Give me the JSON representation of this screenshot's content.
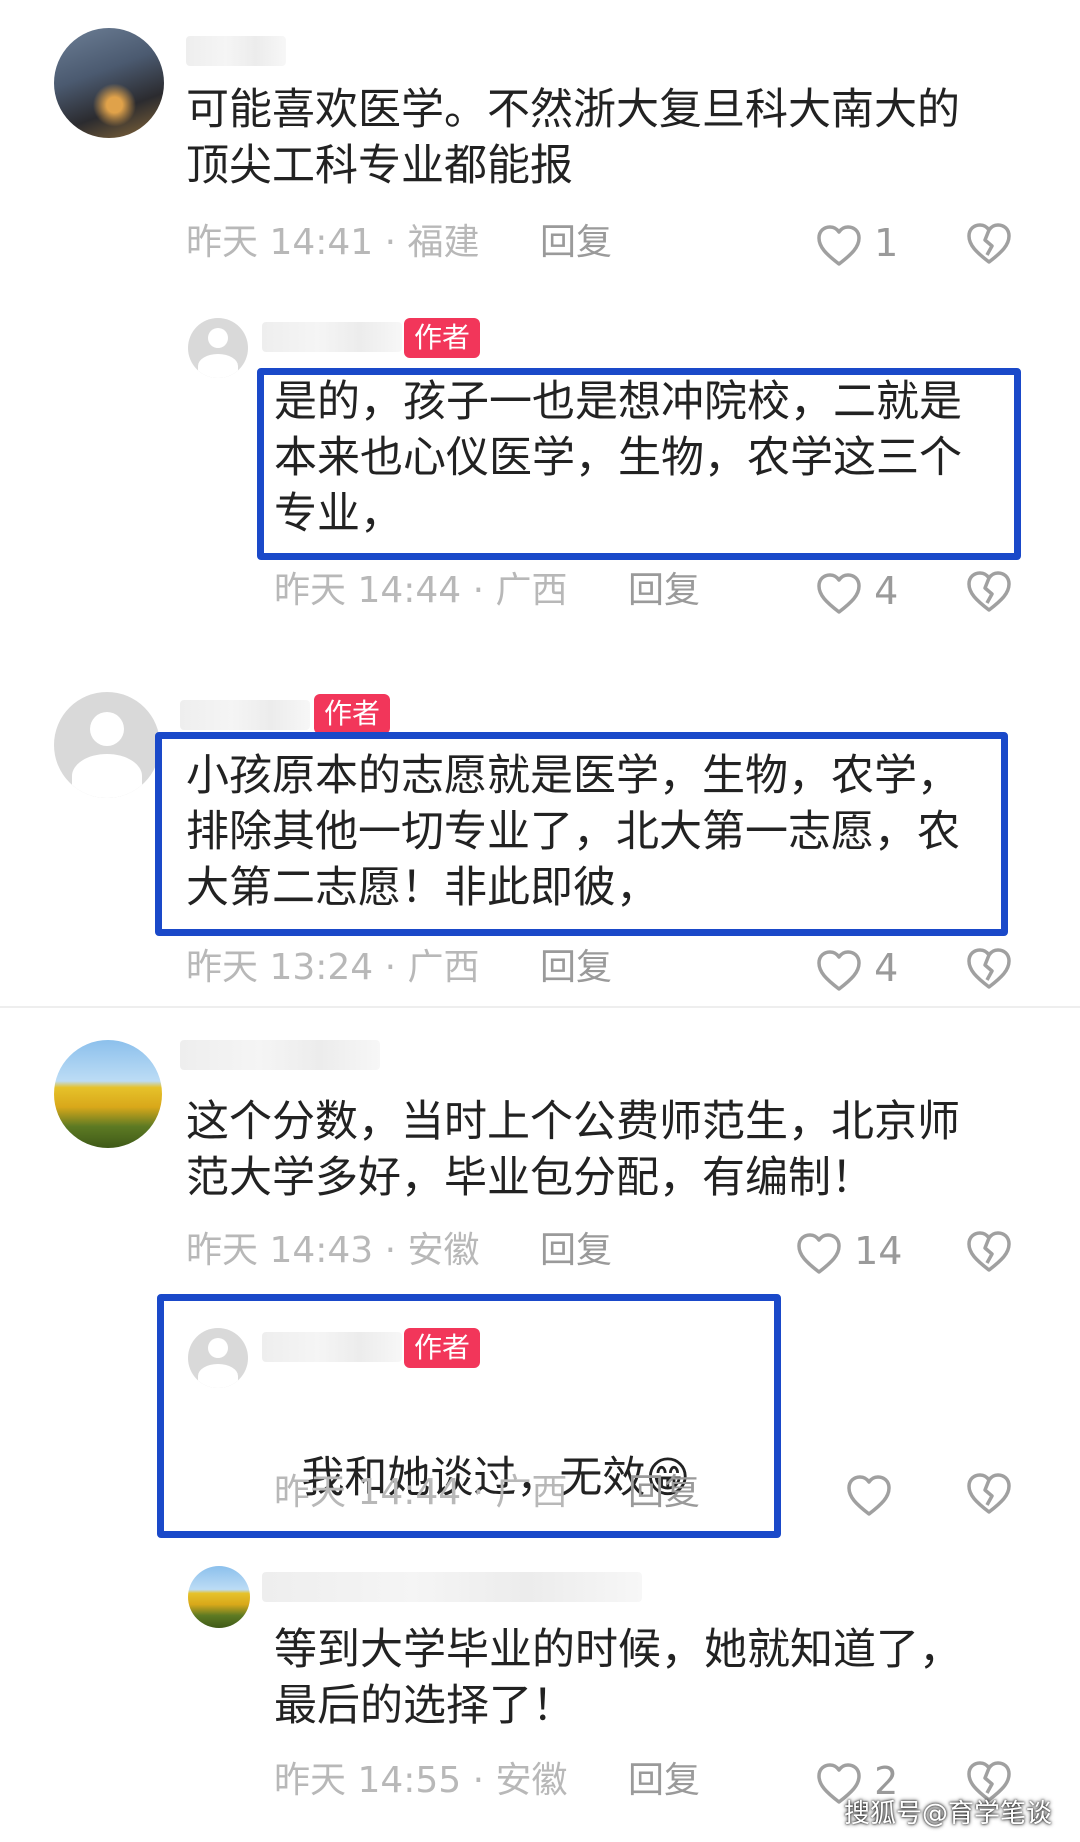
{
  "comments": [
    {
      "text": "可能喜欢医学。不然浙大复旦科大南大的\n顶尖工科专业都能报",
      "meta": "昨天 14:41 · 福建",
      "reply": "回复",
      "likes": "1"
    },
    {
      "badge": "作者",
      "text": "是的，孩子一也是想冲院校，二就是\n本来也心仪医学，生物，农学这三个\n专业，",
      "meta": "昨天 14:44 · 广西",
      "reply": "回复",
      "likes": "4"
    },
    {
      "badge": "作者",
      "text": "小孩原本的志愿就是医学，生物，农学，\n排除其他一切专业了，北大第一志愿，农\n大第二志愿！非此即彼，",
      "meta": "昨天 13:24 · 广西",
      "reply": "回复",
      "likes": "4"
    },
    {
      "text": "这个分数，当时上个公费师范生，北京师\n范大学多好，毕业包分配，有编制！",
      "meta": "昨天 14:43 · 安徽",
      "reply": "回复",
      "likes": "14"
    },
    {
      "badge": "作者",
      "text": "我和她谈过，无效",
      "emoji": "😁",
      "meta": "昨天 14:44 · 广西",
      "reply": "回复",
      "likes": ""
    },
    {
      "text": "等到大学毕业的时候，她就知道了，\n最后的选择了！",
      "meta": "昨天 14:55 · 安徽",
      "reply": "回复",
      "likes": "2"
    }
  ],
  "watermark": "搜狐号@育学笔谈",
  "colors": {
    "highlight_border": "#1a49c9",
    "badge_bg": "#f2365a",
    "meta_text": "#b8b8b8"
  },
  "icons": {
    "like": "heart-outline-icon",
    "dislike": "broken-heart-icon"
  }
}
